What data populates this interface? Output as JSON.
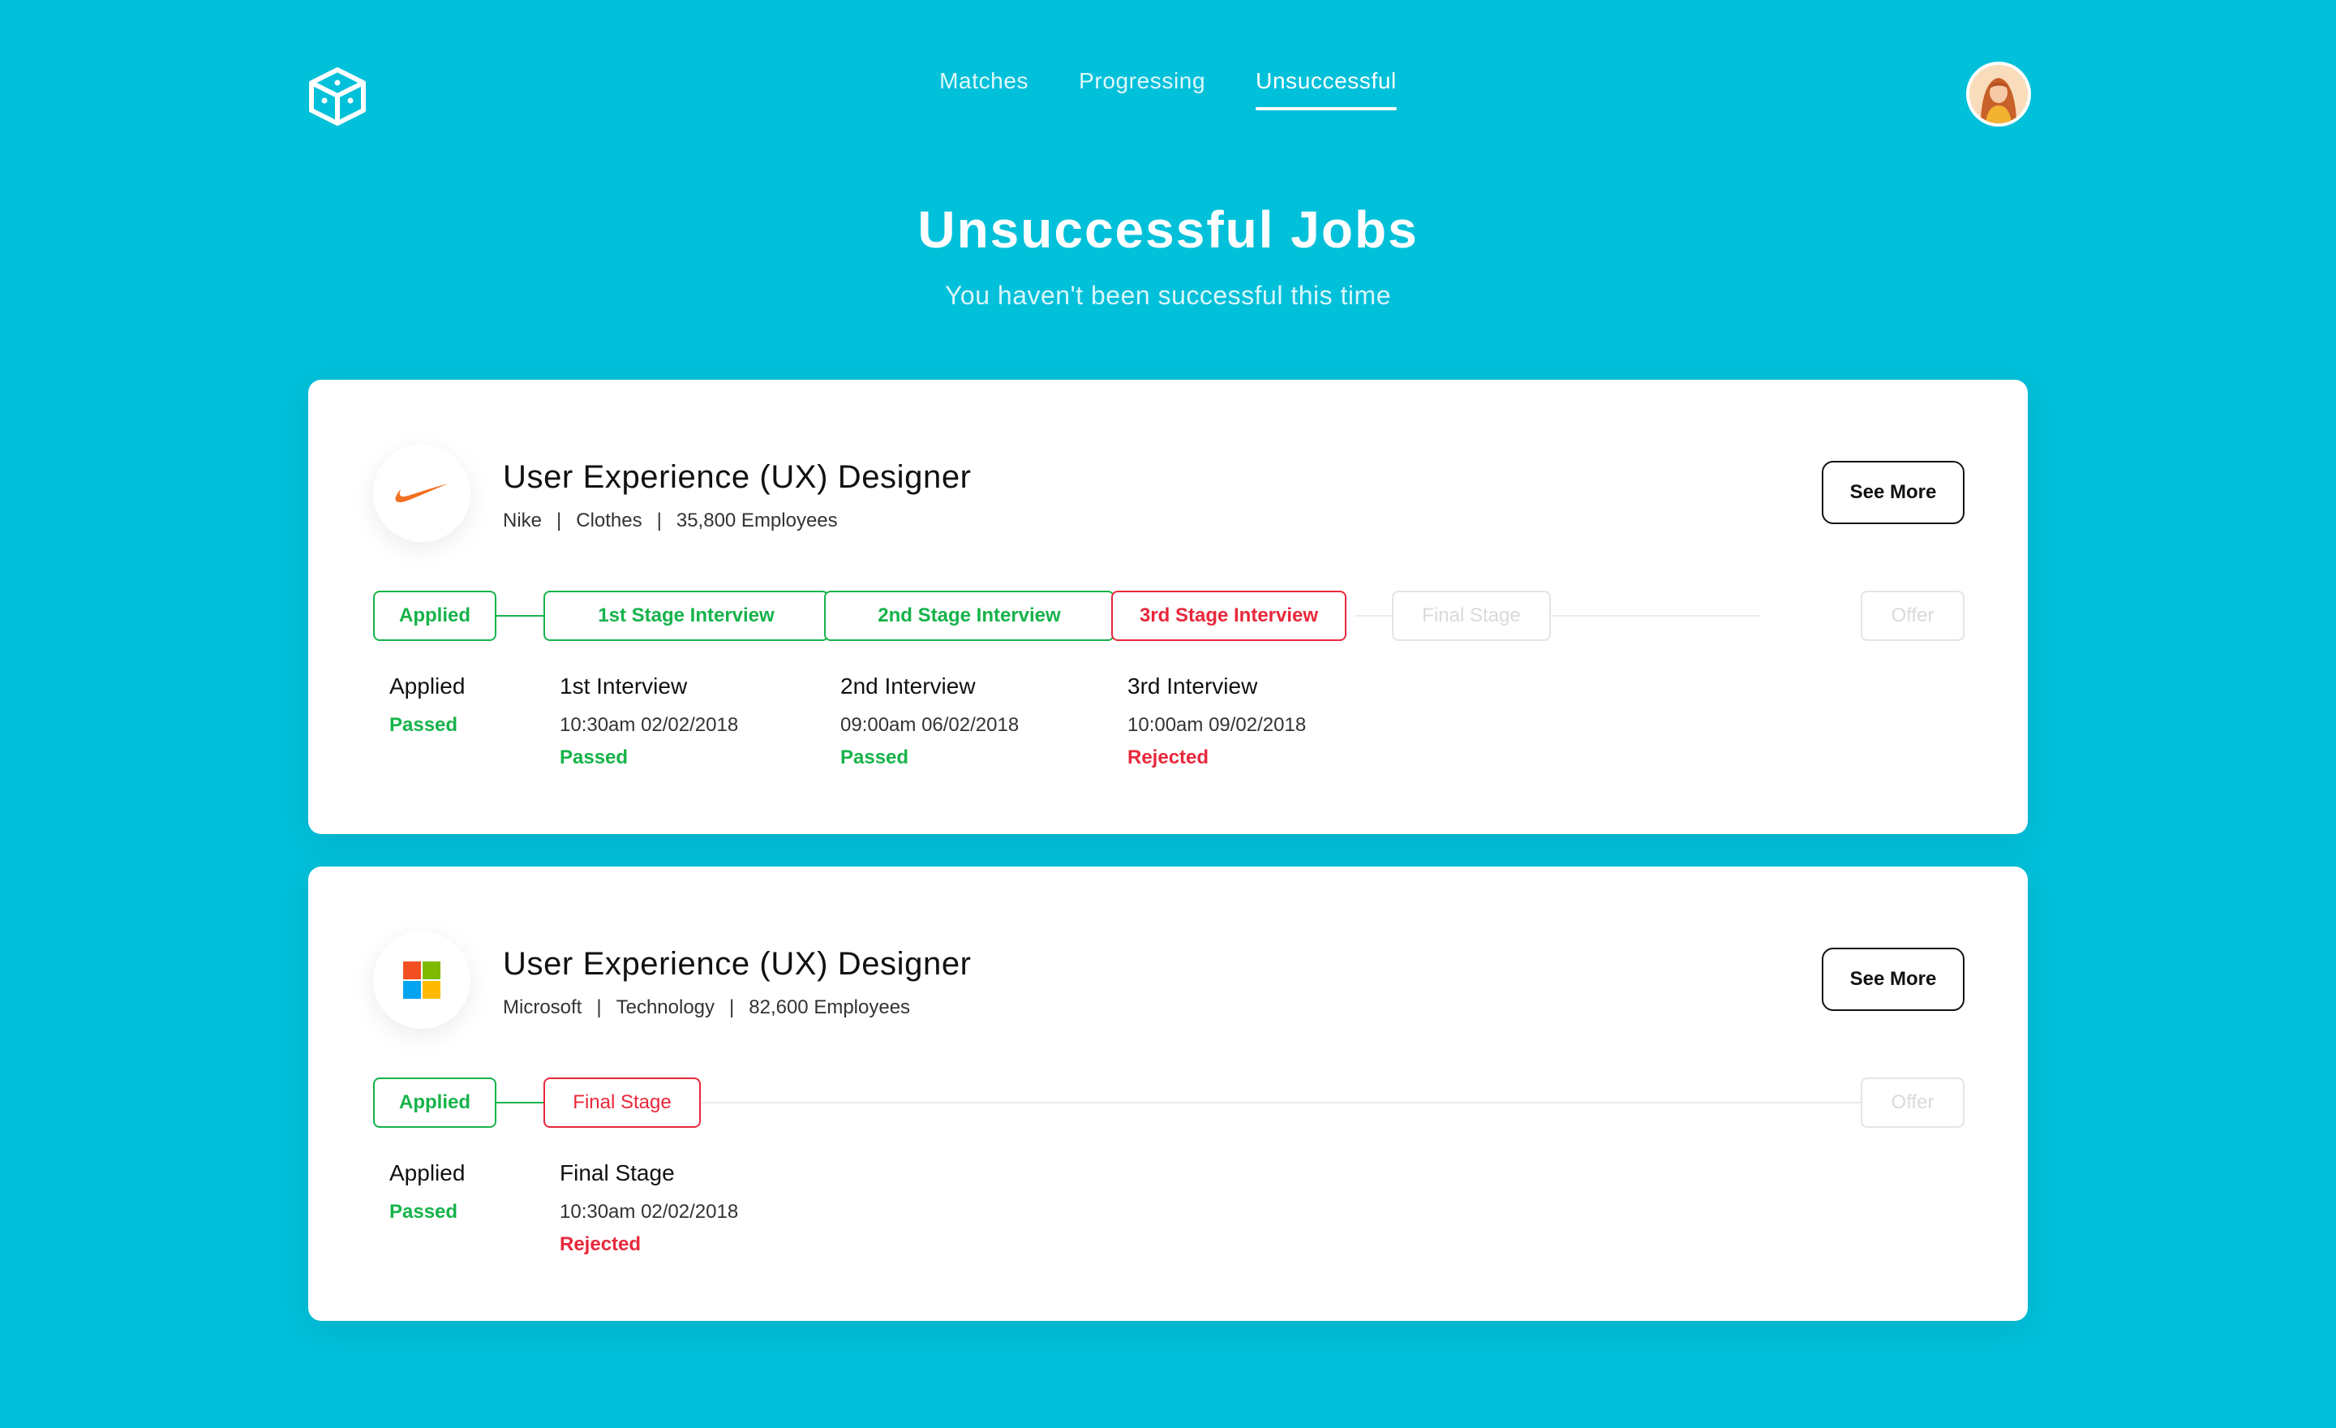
{
  "nav": {
    "tabs": [
      {
        "label": "Matches"
      },
      {
        "label": "Progressing"
      },
      {
        "label": "Unsuccessful"
      }
    ],
    "active_tab": "Unsuccessful"
  },
  "logo_icon": "cube-dice-icon",
  "avatar_icon": "user-avatar",
  "header": {
    "title": "Unsuccessful Jobs",
    "subtitle": "You haven't been successful this time"
  },
  "colors": {
    "background": "#00c0da",
    "passed": "#16b34a",
    "rejected": "#e8283b",
    "inactive": "#e4e4e4",
    "nike": "#f36f21"
  },
  "jobs": [
    {
      "title": "User Experience (UX) Designer",
      "company": "Nike",
      "industry": "Clothes",
      "employees": "35,800 Employees",
      "logo_icon": "nike-swoosh-icon",
      "see_more": "See More",
      "stages": [
        {
          "label": "Applied",
          "status": "passed"
        },
        {
          "label": "1st Stage Interview",
          "status": "passed"
        },
        {
          "label": "2nd Stage Interview",
          "status": "passed"
        },
        {
          "label": "3rd Stage Interview",
          "status": "rejected"
        },
        {
          "label": "Final Stage",
          "status": "inactive"
        },
        {
          "label": "Offer",
          "status": "inactive"
        }
      ],
      "details": [
        {
          "title": "Applied",
          "date": "",
          "status": "Passed"
        },
        {
          "title": "1st Interview",
          "date": "10:30am 02/02/2018",
          "status": "Passed"
        },
        {
          "title": "2nd Interview",
          "date": "09:00am 06/02/2018",
          "status": "Passed"
        },
        {
          "title": "3rd Interview",
          "date": "10:00am 09/02/2018",
          "status": "Rejected"
        }
      ]
    },
    {
      "title": "User Experience (UX) Designer",
      "company": "Microsoft",
      "industry": "Technology",
      "employees": "82,600 Employees",
      "logo_icon": "microsoft-logo-icon",
      "see_more": "See More",
      "stages": [
        {
          "label": "Applied",
          "status": "passed"
        },
        {
          "label": "Final Stage",
          "status": "rejected"
        },
        {
          "label": "Offer",
          "status": "inactive"
        }
      ],
      "details": [
        {
          "title": "Applied",
          "date": "",
          "status": "Passed"
        },
        {
          "title": "Final Stage",
          "date": "10:30am 02/02/2018",
          "status": "Rejected"
        }
      ]
    }
  ]
}
